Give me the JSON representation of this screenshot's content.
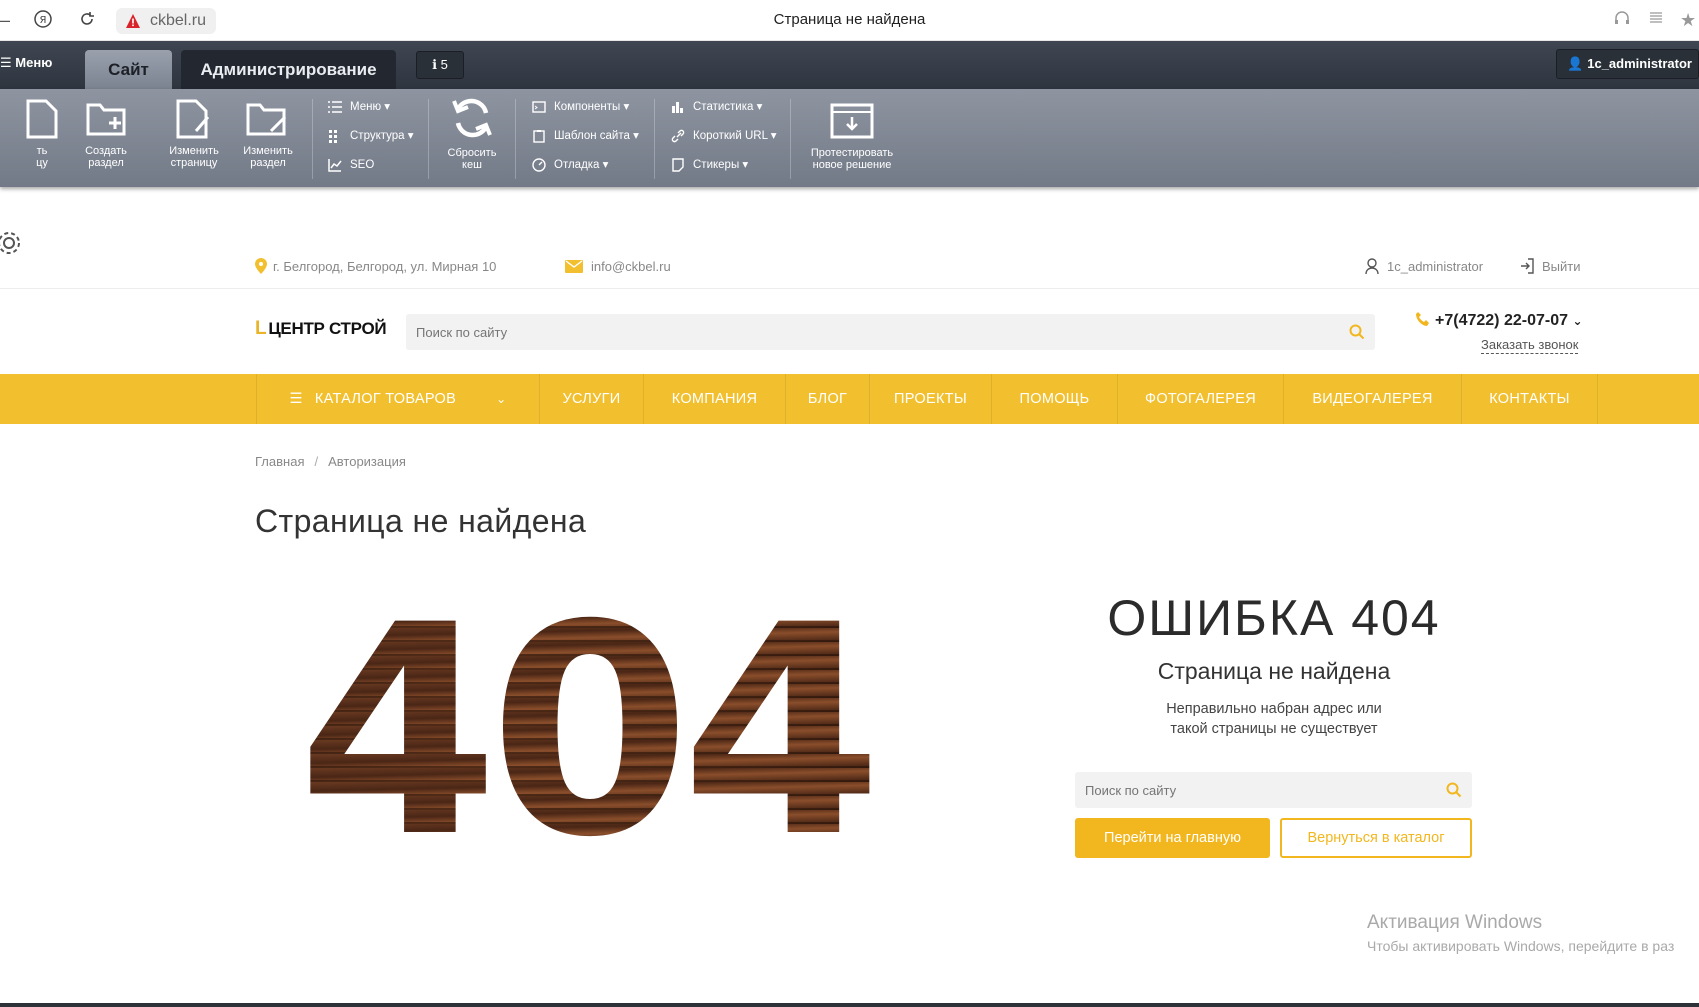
{
  "browser": {
    "url": "ckbel.ru",
    "tab_title": "Страница не найдена"
  },
  "admin": {
    "menu_label": "Меню",
    "tab_site": "Сайт",
    "tab_admin": "Администрирование",
    "notifications": "5",
    "user": "1c_administrator",
    "tools": {
      "create_page": "ть\nцу",
      "create_section": "Создать\nраздел",
      "edit_page": "Изменить\nстраницу",
      "edit_section": "Изменить\nраздел",
      "menu": "Меню",
      "structure": "Структура",
      "seo": "SEO",
      "reset_cache": "Сбросить\nкеш",
      "components": "Компоненты",
      "site_template": "Шаблон сайта",
      "debug": "Отладка",
      "statistics": "Статистика",
      "short_url": "Короткий URL",
      "stickers": "Стикеры",
      "test_solution": "Протестировать\nновое решение"
    }
  },
  "site": {
    "address": "г. Белгород, Белгород, ул. Мирная 10",
    "email": "info@ckbel.ru",
    "user": "1c_administrator",
    "logout": "Выйти",
    "logo_text": "ЦЕНТР СТРОЙ",
    "search_placeholder": "Поиск по сайту",
    "phone": "+7(4722) 22-07-07",
    "callback": "Заказать звонок",
    "nav": [
      "КАТАЛОГ ТОВАРОВ",
      "УСЛУГИ",
      "КОМПАНИЯ",
      "БЛОГ",
      "ПРОЕКТЫ",
      "ПОМОЩЬ",
      "ФОТОГАЛЕРЕЯ",
      "ВИДЕОГАЛЕРЕЯ",
      "КОНТАКТЫ"
    ],
    "breadcrumb": [
      "Главная",
      "Авторизация"
    ],
    "page_title": "Страница не найдена"
  },
  "error": {
    "big_number": "404",
    "title": "ОШИБКА 404",
    "subtitle": "Страница не найдена",
    "text_line1": "Неправильно набран адрес или",
    "text_line2": "такой страницы не существует",
    "search_placeholder": "Поиск по сайту",
    "btn_home": "Перейти на главную",
    "btn_catalog": "Вернуться в каталог"
  },
  "windows": {
    "line1": "Активация Windows",
    "line2": "Чтобы активировать Windows, перейдите в раз"
  },
  "colors": {
    "accent": "#f2c02f",
    "button": "#f2b71e",
    "admin_dark": "#2f353f",
    "admin_tools": "#7f8693"
  }
}
